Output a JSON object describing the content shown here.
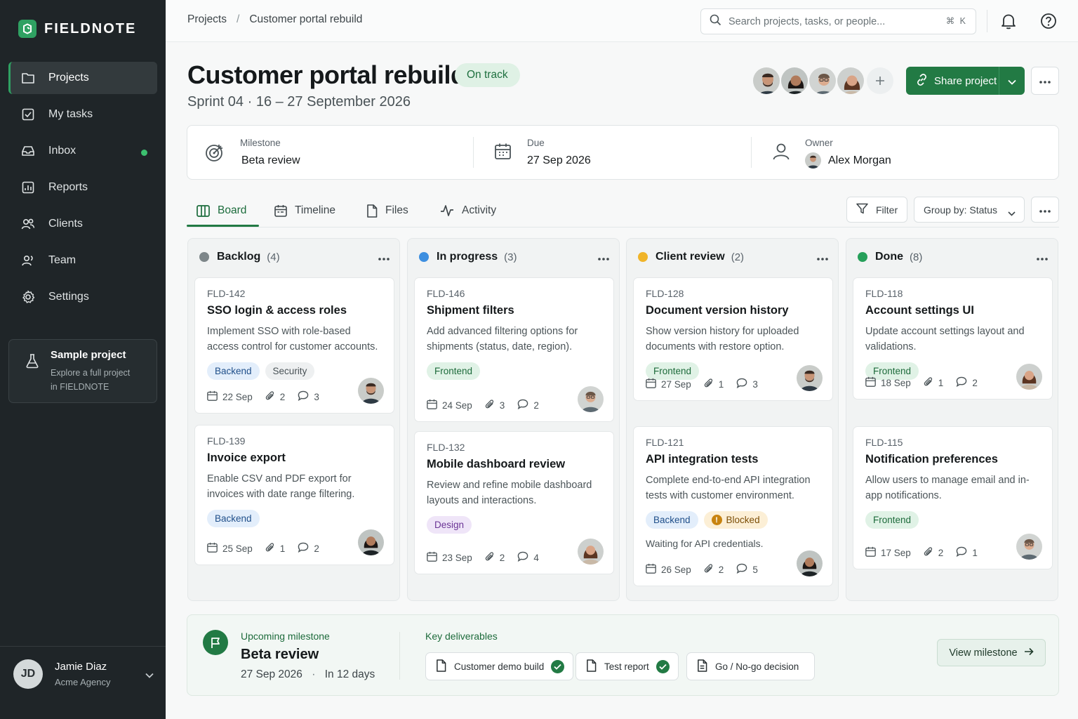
{
  "app": {
    "name": "FIELDNOTE",
    "accent": "#227a44",
    "sidebar_bg": "#1f2528"
  },
  "sidebar": {
    "items": [
      {
        "label": "Projects",
        "icon": "folder-icon",
        "active": true
      },
      {
        "label": "My tasks",
        "icon": "checkbox-icon"
      },
      {
        "label": "Inbox",
        "icon": "inbox-icon",
        "unread_dot": true
      },
      {
        "label": "Reports",
        "icon": "chart-icon"
      },
      {
        "label": "Clients",
        "icon": "clients-icon"
      },
      {
        "label": "Team",
        "icon": "team-icon"
      },
      {
        "label": "Settings",
        "icon": "gear-icon"
      }
    ],
    "sample": {
      "title": "Sample project",
      "line1": "Explore a full project",
      "line2": "in FIELDNOTE"
    },
    "user": {
      "initials": "JD",
      "name": "Jamie Diaz",
      "org": "Acme Agency"
    }
  },
  "topbar": {
    "breadcrumb": [
      "Projects",
      "/",
      "Customer portal rebuild"
    ],
    "search_placeholder": "Search projects, tasks, or people...",
    "shortcut": "⌘ K"
  },
  "header": {
    "title": "Customer portal rebuild",
    "status": "On track",
    "subtitle": "Sprint 04 · 16 – 27 September 2026",
    "share_label": "Share project"
  },
  "info": {
    "milestone": {
      "label": "Milestone",
      "value": "Beta review"
    },
    "due": {
      "label": "Due",
      "value": "27 Sep 2026"
    },
    "owner": {
      "label": "Owner",
      "value": "Alex Morgan"
    }
  },
  "tabs": [
    "Board",
    "Timeline",
    "Files",
    "Activity"
  ],
  "toolbar": {
    "filter": "Filter",
    "group_by": "Group by: Status"
  },
  "columns": [
    {
      "name": "Backlog",
      "count": "(4)",
      "color": "#7d8689",
      "cards": [
        {
          "id": "FLD-142",
          "title": "SSO login & access roles",
          "desc": "Implement SSO with role-based access control for customer accounts.",
          "tags": [
            "Backend",
            "Security"
          ],
          "date": "22 Sep",
          "attachments": "2",
          "comments": "3"
        },
        {
          "id": "FLD-139",
          "title": "Invoice export",
          "desc": "Enable CSV and PDF export for invoices with date range filtering.",
          "tags": [
            "Backend"
          ],
          "date": "25 Sep",
          "attachments": "1",
          "comments": "2"
        }
      ]
    },
    {
      "name": "In progress",
      "count": "(3)",
      "color": "#3d8fe0",
      "cards": [
        {
          "id": "FLD-146",
          "title": "Shipment filters",
          "desc": "Add advanced filtering options for shipments (status, date, region).",
          "tags": [
            "Frontend"
          ],
          "date": "24 Sep",
          "attachments": "3",
          "comments": "2"
        },
        {
          "id": "FLD-132",
          "title": "Mobile dashboard review",
          "desc": "Review and refine mobile dashboard layouts and interactions.",
          "tags": [
            "Design"
          ],
          "date": "23 Sep",
          "attachments": "2",
          "comments": "4"
        }
      ]
    },
    {
      "name": "Client review",
      "count": "(2)",
      "color": "#f0b429",
      "cards": [
        {
          "id": "FLD-128",
          "title": "Document version history",
          "desc": "Show version history for uploaded documents with restore option.",
          "tags": [
            "Frontend"
          ],
          "date": "27 Sep",
          "attachments": "1",
          "comments": "3"
        },
        {
          "id": "FLD-121",
          "title": "API integration tests",
          "desc": "Complete end-to-end API integration tests with customer environment.",
          "tags": [
            "Backend",
            "Blocked"
          ],
          "note": "Waiting for API credentials.",
          "date": "26 Sep",
          "attachments": "2",
          "comments": "5"
        }
      ]
    },
    {
      "name": "Done",
      "count": "(8)",
      "color": "#26a05a",
      "cards": [
        {
          "id": "FLD-118",
          "title": "Account settings UI",
          "desc": "Update account settings layout and validations.",
          "tags": [
            "Frontend"
          ],
          "date": "18 Sep",
          "attachments": "1",
          "comments": "2"
        },
        {
          "id": "FLD-115",
          "title": "Notification preferences",
          "desc": "Allow users to manage email and in-app notifications.",
          "tags": [
            "Frontend"
          ],
          "date": "17 Sep",
          "attachments": "2",
          "comments": "1"
        }
      ]
    }
  ],
  "milestone_panel": {
    "label": "Upcoming milestone",
    "name": "Beta review",
    "date": "27 Sep 2026",
    "remaining": "In 12 days",
    "deliverables_label": "Key deliverables",
    "deliverables": [
      {
        "label": "Customer demo build",
        "done": true
      },
      {
        "label": "Test report",
        "done": true
      },
      {
        "label": "Go / No-go decision",
        "done": false
      }
    ],
    "view_label": "View milestone"
  }
}
